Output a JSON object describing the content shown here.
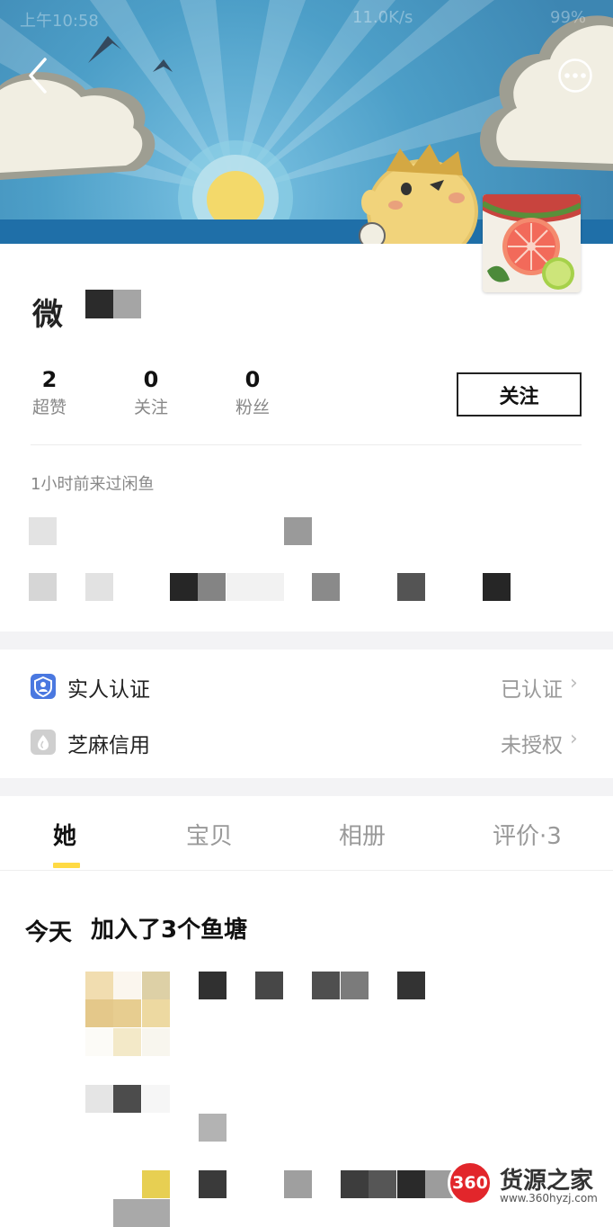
{
  "status_bar": {
    "time": "上午10:58",
    "speed": "11.0K/s",
    "battery": "99%"
  },
  "header": {
    "back_icon": "chevron-left-icon",
    "more_icon": "ellipsis-circle-icon"
  },
  "profile": {
    "name_visible": "微",
    "stats": [
      {
        "value": "2",
        "label": "超赞"
      },
      {
        "value": "0",
        "label": "关注"
      },
      {
        "value": "0",
        "label": "粉丝"
      }
    ],
    "follow_label": "关注",
    "last_seen": "1小时前来过闲鱼"
  },
  "verifications": [
    {
      "title": "实人认证",
      "value": "已认证",
      "icon": "person-verified-icon"
    },
    {
      "title": "芝麻信用",
      "value": "未授权",
      "icon": "sesame-credit-icon"
    }
  ],
  "tabs": [
    {
      "label": "她",
      "active": true
    },
    {
      "label": "宝贝",
      "active": false
    },
    {
      "label": "相册",
      "active": false
    },
    {
      "label": "评价·3",
      "active": false
    }
  ],
  "feed": {
    "day": "今天",
    "title": "加入了3个鱼塘"
  },
  "watermark": {
    "badge": "360",
    "title": "货源之家",
    "url": "www.360hyzj.com"
  },
  "colors": {
    "accent": "#ffda44",
    "banner_sky": "#4a9ac4",
    "verified_blue": "#4a78e0",
    "watermark_red": "#e2262b"
  }
}
